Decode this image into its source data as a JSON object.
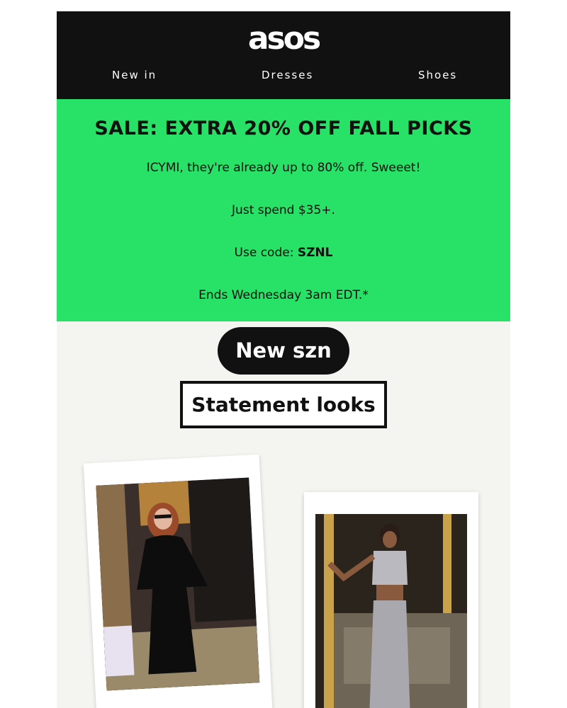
{
  "brand": {
    "logo": "asos"
  },
  "nav": {
    "items": [
      "New in",
      "Dresses",
      "Shoes"
    ]
  },
  "sale": {
    "headline": "SALE: EXTRA 20% OFF FALL PICKS",
    "line1": "ICYMI, they're already up to 80% off. Sweeet!",
    "line2": "Just spend $35+.",
    "code_label": "Use code: ",
    "code": "SZNL",
    "line4": "Ends Wednesday 3am EDT.*"
  },
  "buttons": {
    "new_szn": "New szn",
    "statement_looks": "Statement looks"
  },
  "colors": {
    "header_bg": "#111111",
    "sale_bg": "#28e167",
    "page_bg": "#f4f4f0"
  }
}
